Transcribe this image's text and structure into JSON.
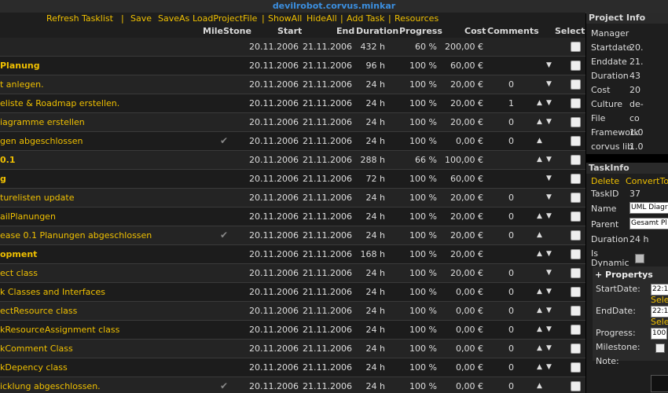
{
  "window": {
    "title": "devilrobot.corvus.minkar"
  },
  "menu": {
    "refresh": "Refresh Tasklist",
    "save": "Save",
    "saveas": "SaveAs",
    "load": "LoadProjectFile",
    "showall": "ShowAll",
    "hideall": "HideAll",
    "addtask": "Add Task",
    "resources": "Resources",
    "sep": "|"
  },
  "columns": {
    "milestone": "MileStone",
    "start": "Start",
    "end": "End",
    "duration": "Duration",
    "progress": "Progress",
    "cost": "Cost",
    "comments": "Comments",
    "select": "Select"
  },
  "tasks": [
    {
      "name": "",
      "type": "sum",
      "milestone": "",
      "start": "20.11.2006",
      "end": "21.11.2006",
      "duration": "432 h",
      "progress": "60 %",
      "cost": "200,00 €",
      "comments": "",
      "up": "",
      "down": ""
    },
    {
      "name": "Planung",
      "type": "sum",
      "milestone": "",
      "start": "20.11.2006",
      "end": "21.11.2006",
      "duration": "96 h",
      "progress": "100 %",
      "cost": "60,00 €",
      "comments": "",
      "up": "",
      "down": "▼"
    },
    {
      "name": "t anlegen.",
      "type": "task",
      "milestone": "",
      "start": "20.11.2006",
      "end": "21.11.2006",
      "duration": "24 h",
      "progress": "100 %",
      "cost": "20,00 €",
      "comments": "0",
      "up": "",
      "down": "▼"
    },
    {
      "name": "eliste & Roadmap erstellen.",
      "type": "task",
      "milestone": "",
      "start": "20.11.2006",
      "end": "21.11.2006",
      "duration": "24 h",
      "progress": "100 %",
      "cost": "20,00 €",
      "comments": "1",
      "up": "▲",
      "down": "▼"
    },
    {
      "name": "iagramme erstellen",
      "type": "task",
      "milestone": "",
      "start": "20.11.2006",
      "end": "21.11.2006",
      "duration": "24 h",
      "progress": "100 %",
      "cost": "20,00 €",
      "comments": "0",
      "up": "▲",
      "down": "▼"
    },
    {
      "name": "gen abgeschlossen",
      "type": "task",
      "milestone": "✔",
      "start": "20.11.2006",
      "end": "21.11.2006",
      "duration": "24 h",
      "progress": "100 %",
      "cost": "0,00 €",
      "comments": "0",
      "up": "▲",
      "down": ""
    },
    {
      "name": "0.1",
      "type": "sum",
      "milestone": "",
      "start": "20.11.2006",
      "end": "21.11.2006",
      "duration": "288 h",
      "progress": "66 %",
      "cost": "100,00 €",
      "comments": "",
      "up": "▲",
      "down": "▼"
    },
    {
      "name": "g",
      "type": "sum",
      "milestone": "",
      "start": "20.11.2006",
      "end": "21.11.2006",
      "duration": "72 h",
      "progress": "100 %",
      "cost": "60,00 €",
      "comments": "",
      "up": "",
      "down": "▼"
    },
    {
      "name": "turelisten update",
      "type": "task",
      "milestone": "",
      "start": "20.11.2006",
      "end": "21.11.2006",
      "duration": "24 h",
      "progress": "100 %",
      "cost": "20,00 €",
      "comments": "0",
      "up": "",
      "down": "▼"
    },
    {
      "name": "ailPlanungen",
      "type": "task",
      "milestone": "",
      "start": "20.11.2006",
      "end": "21.11.2006",
      "duration": "24 h",
      "progress": "100 %",
      "cost": "20,00 €",
      "comments": "0",
      "up": "▲",
      "down": "▼"
    },
    {
      "name": "ease 0.1 Planungen abgeschlossen",
      "type": "task",
      "milestone": "✔",
      "start": "20.11.2006",
      "end": "21.11.2006",
      "duration": "24 h",
      "progress": "100 %",
      "cost": "20,00 €",
      "comments": "0",
      "up": "▲",
      "down": ""
    },
    {
      "name": "opment",
      "type": "sum",
      "milestone": "",
      "start": "20.11.2006",
      "end": "21.11.2006",
      "duration": "168 h",
      "progress": "100 %",
      "cost": "20,00 €",
      "comments": "",
      "up": "▲",
      "down": "▼"
    },
    {
      "name": "ect class",
      "type": "task",
      "milestone": "",
      "start": "20.11.2006",
      "end": "21.11.2006",
      "duration": "24 h",
      "progress": "100 %",
      "cost": "20,00 €",
      "comments": "0",
      "up": "",
      "down": "▼"
    },
    {
      "name": "k Classes and Interfaces",
      "type": "task",
      "milestone": "",
      "start": "20.11.2006",
      "end": "21.11.2006",
      "duration": "24 h",
      "progress": "100 %",
      "cost": "0,00 €",
      "comments": "0",
      "up": "▲",
      "down": "▼"
    },
    {
      "name": "ectResource class",
      "type": "task",
      "milestone": "",
      "start": "20.11.2006",
      "end": "21.11.2006",
      "duration": "24 h",
      "progress": "100 %",
      "cost": "0,00 €",
      "comments": "0",
      "up": "▲",
      "down": "▼"
    },
    {
      "name": "kResourceAssignment class",
      "type": "task",
      "milestone": "",
      "start": "20.11.2006",
      "end": "21.11.2006",
      "duration": "24 h",
      "progress": "100 %",
      "cost": "0,00 €",
      "comments": "0",
      "up": "▲",
      "down": "▼"
    },
    {
      "name": "kComment Class",
      "type": "task",
      "milestone": "",
      "start": "20.11.2006",
      "end": "21.11.2006",
      "duration": "24 h",
      "progress": "100 %",
      "cost": "0,00 €",
      "comments": "0",
      "up": "▲",
      "down": "▼"
    },
    {
      "name": "kDepency class",
      "type": "task",
      "milestone": "",
      "start": "20.11.2006",
      "end": "21.11.2006",
      "duration": "24 h",
      "progress": "100 %",
      "cost": "0,00 €",
      "comments": "0",
      "up": "▲",
      "down": "▼"
    },
    {
      "name": "icklung abgeschlossen.",
      "type": "task",
      "milestone": "✔",
      "start": "20.11.2006",
      "end": "21.11.2006",
      "duration": "24 h",
      "progress": "100 %",
      "cost": "0,00 €",
      "comments": "0",
      "up": "▲",
      "down": ""
    }
  ],
  "project_info": {
    "title": "Project Info",
    "manager_label": "Manager",
    "manager": "",
    "startdate_label": "Startdate",
    "startdate": "20.",
    "enddate_label": "Enddate",
    "enddate": "21.",
    "duration_label": "Duration",
    "duration": "43",
    "cost_label": "Cost",
    "cost": "20",
    "culture_label": "Culture",
    "culture": "de-",
    "file_label": "File",
    "file": "co",
    "framework_label": "Framework",
    "framework": "1.0",
    "corvuslib_label": "corvus lib",
    "corvuslib": "1.0"
  },
  "task_info": {
    "title": "TaskInfo",
    "delete": "Delete",
    "convert": "ConvertTo",
    "taskid_label": "TaskID",
    "taskid": "37",
    "name_label": "Name",
    "name": "UML Diagra",
    "parent_label": "Parent",
    "parent": "Gesamt Pl",
    "duration_label": "Duration",
    "duration": "24 h",
    "isdynamic_label": "Is Dynamic",
    "propertys_label": "+ Propertys",
    "startdate_label": "StartDate:",
    "startdate": "22:1",
    "select1": "Sele",
    "enddate_label": "EndDate:",
    "enddate": "22:1",
    "select2": "Sele",
    "progress_label": "Progress:",
    "progress": "100",
    "milestone_label": "Milestone:",
    "note_label": "Note:"
  }
}
